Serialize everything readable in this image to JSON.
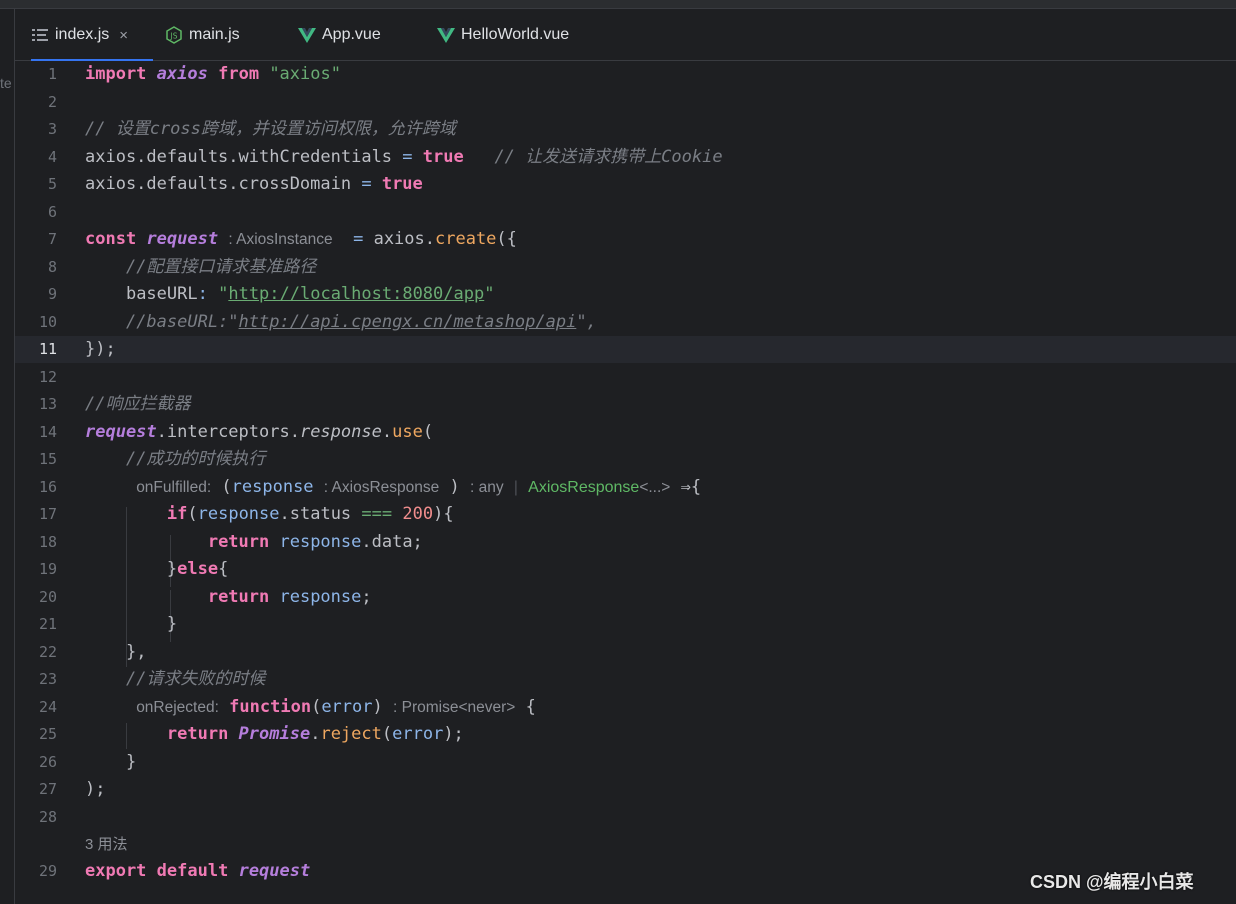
{
  "tabs": [
    {
      "label": "index.js",
      "icon": "list-file-icon",
      "active": true,
      "closable": true
    },
    {
      "label": "main.js",
      "icon": "nodejs-icon",
      "active": false
    },
    {
      "label": "App.vue",
      "icon": "vue-icon",
      "active": false
    },
    {
      "label": "HelloWorld.vue",
      "icon": "vue-icon",
      "active": false
    }
  ],
  "left_fragment": "te",
  "close_glyph": "×",
  "current_line": "11",
  "lines": {
    "l1": {
      "n": "1",
      "kw1": "import",
      "v": "axios",
      "kw2": "from",
      "s": "\"axios\""
    },
    "l2": {
      "n": "2"
    },
    "l3": {
      "n": "3",
      "c": "// 设置cross跨域，并设置访问权限，允许跨域"
    },
    "l4": {
      "n": "4",
      "a": "axios.defaults.withCredentials",
      "op": " = ",
      "kw": "true",
      "c": "// 让发送请求携带上Cookie"
    },
    "l5": {
      "n": "5",
      "a": "axios.defaults.crossDomain",
      "op": " = ",
      "kw": "true"
    },
    "l6": {
      "n": "6"
    },
    "l7": {
      "n": "7",
      "kw": "const",
      "v": "request",
      "hint": ": AxiosInstance",
      "op": " = ",
      "obj": "axios.",
      "fn": "create",
      "tail": "({"
    },
    "l8": {
      "n": "8",
      "c": "//配置接口请求基准路径"
    },
    "l9": {
      "n": "9",
      "k": "baseURL",
      "colon": ": ",
      "q1": "\"",
      "url": "http://localhost:8080/app",
      "q2": "\""
    },
    "l10": {
      "n": "10",
      "c1": "//baseURL:\"",
      "url": "http://api.cpengx.cn/metashop/api",
      "c2": "\","
    },
    "l11": {
      "n": "11",
      "t": "});"
    },
    "l12": {
      "n": "12"
    },
    "l13": {
      "n": "13",
      "c": "//响应拦截器"
    },
    "l14": {
      "n": "14",
      "v": "request",
      "a": ".interceptors.",
      "p": "response",
      "dot": ".",
      "fn": "use",
      "tail": "("
    },
    "l15": {
      "n": "15",
      "c": "//成功的时候执行"
    },
    "l16": {
      "n": "16",
      "h1": "onFulfilled:",
      "o": "(",
      "p": "response",
      "h2": ": AxiosResponse",
      "cl": ")",
      "h3": ": any",
      "g": "AxiosResponse",
      "h4": "<...>",
      "arrow": " ⇒{"
    },
    "l17": {
      "n": "17",
      "kw": "if",
      "o": "(",
      "p": "response",
      "a": ".status ",
      "op": "===",
      "num": " 200",
      "cl": "){"
    },
    "l18": {
      "n": "18",
      "kw": "return",
      "p": " response",
      "a": ".data;"
    },
    "l19": {
      "n": "19",
      "b": "}",
      "kw": "else",
      "t": "{"
    },
    "l20": {
      "n": "20",
      "kw": "return",
      "p": " response",
      "a": ";"
    },
    "l21": {
      "n": "21",
      "t": "}"
    },
    "l22": {
      "n": "22",
      "t": "},"
    },
    "l23": {
      "n": "23",
      "c": "//请求失败的时候"
    },
    "l24": {
      "n": "24",
      "h1": "onRejected:",
      "kw": "function",
      "o": "(",
      "p": "error",
      "cl": ")",
      "h2": ": Promise<never>",
      "t": " {"
    },
    "l25": {
      "n": "25",
      "kw": "return",
      "v": " Promise",
      "dot": ".",
      "fn": "reject",
      "o": "(",
      "p": "error",
      "cl": ");"
    },
    "l26": {
      "n": "26",
      "t": "}"
    },
    "l27": {
      "n": "27",
      "t": ");"
    },
    "l28": {
      "n": "28"
    },
    "usages": "3 用法",
    "l29": {
      "n": "29",
      "kw1": "export",
      "kw2": "default",
      "v": "request"
    }
  },
  "watermark_bottom": "CSDN @编程小白菜",
  "colors": {
    "accent": "#3574f0",
    "keyword": "#f07ab4",
    "string": "#6aab73",
    "comment": "#7a7e85",
    "variable": "#b57edc",
    "function": "#eea760",
    "number": "#f08d8d",
    "param": "#8db5e8"
  }
}
